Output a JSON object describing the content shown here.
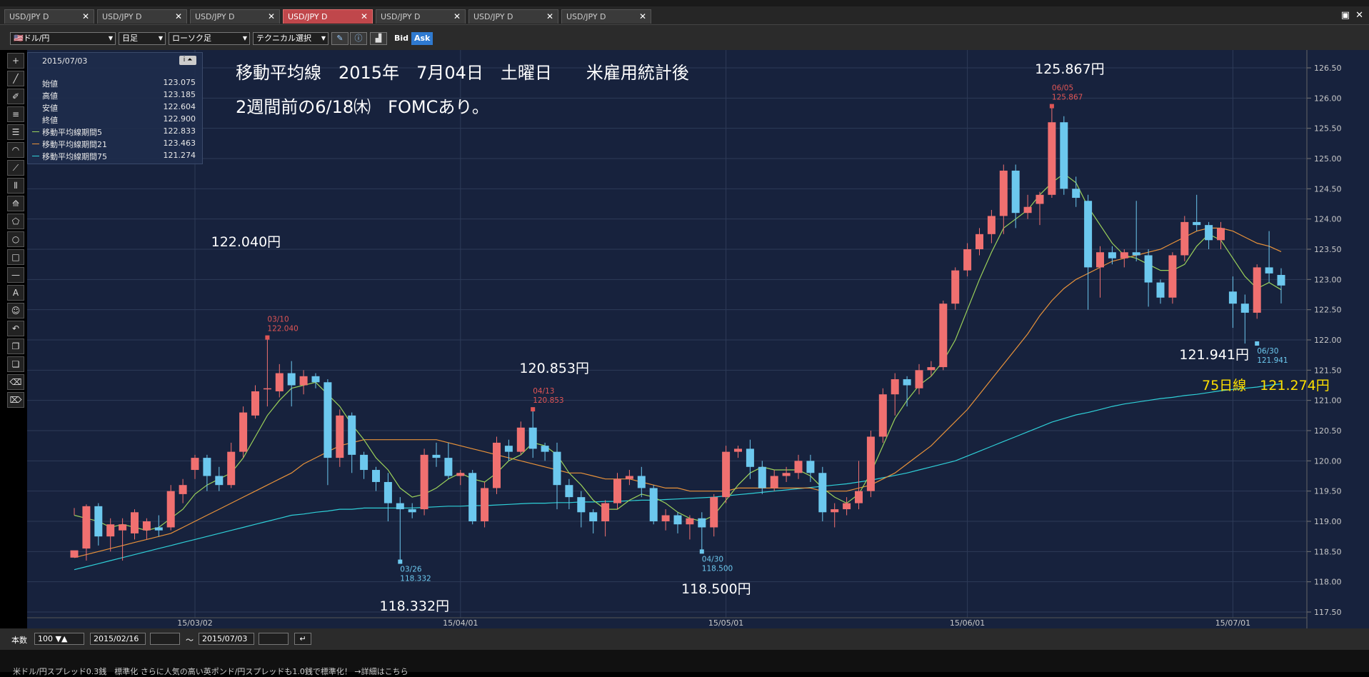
{
  "tabs": [
    {
      "label": "USD/JPY D",
      "active": false
    },
    {
      "label": "USD/JPY D",
      "active": false
    },
    {
      "label": "USD/JPY D",
      "active": false
    },
    {
      "label": "USD/JPY D",
      "active": true
    },
    {
      "label": "USD/JPY D",
      "active": false
    },
    {
      "label": "USD/JPY D",
      "active": false
    },
    {
      "label": "USD/JPY D",
      "active": false
    }
  ],
  "toolbar": {
    "pair": "ドル/円",
    "timeframe": "日足",
    "chart_type": "ローソク足",
    "technical": "テクニカル選択",
    "bid": "Bid",
    "ask": "Ask"
  },
  "info": {
    "date": "2015/07/03",
    "rows": [
      {
        "label": "始値",
        "value": "123.075",
        "color": ""
      },
      {
        "label": "高値",
        "value": "123.185",
        "color": ""
      },
      {
        "label": "安値",
        "value": "122.604",
        "color": ""
      },
      {
        "label": "終値",
        "value": "122.900",
        "color": ""
      },
      {
        "label": "移動平均線期間5",
        "value": "122.833",
        "color": "#9bd15a"
      },
      {
        "label": "移動平均線期間21",
        "value": "123.463",
        "color": "#e8923a"
      },
      {
        "label": "移動平均線期間75",
        "value": "121.274",
        "color": "#2fd0d8"
      }
    ]
  },
  "annotations": {
    "title_line1": "移動平均線　2015年　7月04日　土曜日　　米雇用統計後",
    "title_line2": "2週間前の6/18㈭　FOMCあり。",
    "ma75_label": "75日線　121.274円",
    "callouts": [
      {
        "text": "122.040円",
        "date": "03/10",
        "price": "122.040",
        "kind": "high"
      },
      {
        "text": "118.332円",
        "date": "03/26",
        "price": "118.332",
        "kind": "low"
      },
      {
        "text": "120.853円",
        "date": "04/13",
        "price": "120.853",
        "kind": "high"
      },
      {
        "text": "118.500円",
        "date": "04/30",
        "price": "118.500",
        "kind": "low"
      },
      {
        "text": "125.867円",
        "date": "06/05",
        "price": "125.867",
        "kind": "high"
      },
      {
        "text": "121.941円",
        "date": "06/30",
        "price": "121.941",
        "kind": "low"
      }
    ]
  },
  "bottom": {
    "count_label": "本数",
    "count": "100",
    "from": "2015/02/16",
    "sep": "～",
    "to": "2015/07/03"
  },
  "footer_text": "米ドル/円スプレッド0.3銭　標準化 さらに人気の高い英ポンド/円スプレッドも1.0銭で標準化！ →詳細はこちら",
  "chart_data": {
    "type": "candlestick",
    "symbol": "USD/JPY D",
    "ylim": [
      117.5,
      126.5
    ],
    "yticks": [
      "117.50",
      "118.00",
      "118.50",
      "119.00",
      "119.50",
      "120.00",
      "120.50",
      "121.00",
      "121.50",
      "122.00",
      "122.50",
      "123.00",
      "123.50",
      "124.00",
      "124.50",
      "125.00",
      "125.50",
      "126.00",
      "126.50"
    ],
    "xticks": [
      {
        "label": "15/03/02",
        "index": 10
      },
      {
        "label": "15/04/01",
        "index": 32
      },
      {
        "label": "15/05/01",
        "index": 54
      },
      {
        "label": "15/06/01",
        "index": 74
      },
      {
        "label": "15/07/01",
        "index": 96
      }
    ],
    "candles": [
      [
        118.4,
        118.52,
        119.1,
        119.22
      ],
      [
        118.55,
        119.25,
        118.35,
        119.28
      ],
      [
        119.25,
        118.75,
        118.6,
        119.3
      ],
      [
        118.75,
        118.95,
        118.5,
        119.05
      ],
      [
        118.85,
        118.95,
        118.35,
        119.05
      ],
      [
        118.8,
        119.15,
        118.7,
        119.2
      ],
      [
        118.85,
        119.0,
        118.7,
        119.05
      ],
      [
        118.9,
        118.85,
        118.75,
        119.1
      ],
      [
        118.9,
        119.5,
        118.85,
        119.6
      ],
      [
        119.45,
        119.6,
        119.3,
        119.7
      ],
      [
        119.85,
        120.05,
        119.7,
        120.1
      ],
      [
        120.05,
        119.75,
        119.5,
        120.1
      ],
      [
        119.75,
        119.6,
        119.5,
        119.9
      ],
      [
        119.6,
        120.15,
        119.55,
        120.3
      ],
      [
        120.15,
        120.8,
        120.05,
        120.9
      ],
      [
        120.75,
        121.15,
        120.7,
        121.25
      ],
      [
        121.2,
        121.2,
        120.9,
        122.04
      ],
      [
        121.15,
        121.45,
        121.05,
        121.6
      ],
      [
        121.45,
        121.25,
        120.9,
        121.65
      ],
      [
        121.25,
        121.4,
        121.1,
        121.5
      ],
      [
        121.4,
        121.3,
        121.2,
        121.45
      ],
      [
        121.3,
        120.05,
        119.6,
        121.35
      ],
      [
        120.05,
        120.75,
        119.9,
        120.85
      ],
      [
        120.75,
        120.1,
        119.8,
        120.8
      ],
      [
        120.1,
        119.85,
        119.7,
        120.15
      ],
      [
        119.85,
        119.65,
        119.5,
        119.9
      ],
      [
        119.65,
        119.3,
        119.0,
        119.8
      ],
      [
        119.3,
        119.2,
        118.33,
        119.4
      ],
      [
        119.2,
        119.15,
        119.05,
        119.3
      ],
      [
        119.2,
        120.1,
        119.1,
        120.2
      ],
      [
        120.1,
        120.05,
        119.9,
        120.3
      ],
      [
        120.05,
        119.75,
        119.7,
        120.3
      ],
      [
        119.75,
        119.8,
        119.6,
        119.85
      ],
      [
        119.8,
        119.0,
        118.95,
        119.85
      ],
      [
        119.0,
        119.55,
        118.9,
        119.65
      ],
      [
        119.55,
        120.3,
        119.45,
        120.4
      ],
      [
        120.25,
        120.15,
        120.0,
        120.35
      ],
      [
        120.15,
        120.55,
        120.1,
        120.65
      ],
      [
        120.55,
        120.2,
        120.05,
        120.85
      ],
      [
        120.25,
        120.15,
        120.0,
        120.3
      ],
      [
        120.15,
        119.6,
        119.2,
        120.3
      ],
      [
        119.6,
        119.4,
        119.2,
        119.7
      ],
      [
        119.4,
        119.15,
        118.9,
        119.5
      ],
      [
        119.15,
        119.0,
        118.8,
        119.2
      ],
      [
        119.0,
        119.3,
        118.75,
        119.35
      ],
      [
        119.3,
        119.7,
        119.2,
        119.8
      ],
      [
        119.7,
        119.75,
        119.6,
        119.85
      ],
      [
        119.75,
        119.55,
        119.4,
        119.9
      ],
      [
        119.55,
        119.0,
        118.95,
        119.6
      ],
      [
        119.0,
        119.1,
        118.85,
        119.2
      ],
      [
        119.1,
        118.95,
        118.8,
        119.15
      ],
      [
        118.95,
        119.05,
        118.7,
        119.1
      ],
      [
        119.05,
        118.9,
        118.5,
        119.15
      ],
      [
        118.9,
        119.4,
        118.75,
        119.45
      ],
      [
        119.4,
        120.15,
        119.3,
        120.25
      ],
      [
        120.15,
        120.2,
        120.05,
        120.25
      ],
      [
        120.2,
        119.9,
        119.7,
        120.35
      ],
      [
        119.9,
        119.55,
        119.45,
        120.0
      ],
      [
        119.55,
        119.75,
        119.5,
        119.85
      ],
      [
        119.75,
        119.8,
        119.65,
        119.9
      ],
      [
        119.8,
        120.0,
        119.7,
        120.1
      ],
      [
        120.0,
        119.8,
        119.65,
        120.1
      ],
      [
        119.8,
        119.15,
        119.0,
        119.9
      ],
      [
        119.15,
        119.2,
        118.9,
        119.3
      ],
      [
        119.2,
        119.3,
        119.1,
        119.4
      ],
      [
        119.3,
        119.5,
        119.2,
        120.0
      ],
      [
        119.5,
        120.4,
        119.4,
        120.5
      ],
      [
        120.4,
        121.1,
        120.3,
        121.2
      ],
      [
        121.1,
        121.35,
        120.75,
        121.45
      ],
      [
        121.35,
        121.25,
        120.9,
        121.4
      ],
      [
        121.2,
        121.5,
        121.1,
        121.6
      ],
      [
        121.5,
        121.55,
        121.4,
        121.65
      ],
      [
        121.55,
        122.6,
        121.5,
        122.65
      ],
      [
        122.6,
        123.15,
        122.5,
        123.2
      ],
      [
        123.15,
        123.5,
        123.05,
        123.6
      ],
      [
        123.5,
        123.75,
        123.4,
        123.85
      ],
      [
        123.75,
        124.05,
        123.6,
        124.15
      ],
      [
        124.05,
        124.8,
        123.75,
        124.9
      ],
      [
        124.8,
        124.1,
        123.85,
        124.9
      ],
      [
        124.1,
        124.2,
        124.0,
        124.4
      ],
      [
        124.25,
        124.4,
        123.9,
        124.45
      ],
      [
        124.4,
        125.6,
        124.35,
        125.87
      ],
      [
        125.6,
        124.5,
        124.4,
        125.7
      ],
      [
        124.5,
        124.35,
        124.2,
        124.7
      ],
      [
        124.3,
        123.2,
        122.5,
        124.4
      ],
      [
        123.2,
        123.45,
        122.7,
        123.55
      ],
      [
        123.45,
        123.35,
        123.25,
        123.55
      ],
      [
        123.35,
        123.45,
        123.2,
        123.5
      ],
      [
        123.45,
        123.4,
        123.3,
        124.3
      ],
      [
        123.4,
        122.95,
        122.55,
        123.5
      ],
      [
        122.95,
        122.7,
        122.6,
        123.0
      ],
      [
        122.7,
        123.4,
        122.6,
        123.45
      ],
      [
        123.4,
        123.95,
        123.3,
        124.05
      ],
      [
        123.95,
        123.9,
        123.8,
        124.4
      ],
      [
        123.9,
        123.65,
        123.5,
        123.95
      ],
      [
        123.65,
        123.85,
        123.5,
        123.95
      ],
      [
        122.8,
        122.6,
        122.2,
        123.05
      ],
      [
        122.6,
        122.45,
        121.94,
        122.75
      ],
      [
        122.45,
        123.2,
        122.35,
        123.25
      ],
      [
        123.2,
        123.1,
        122.95,
        123.8
      ],
      [
        123.075,
        122.9,
        122.604,
        123.185
      ]
    ],
    "ma5": [
      119.1,
      119.05,
      119.0,
      118.9,
      118.95,
      118.9,
      118.85,
      118.9,
      119.05,
      119.2,
      119.45,
      119.6,
      119.7,
      119.8,
      120.05,
      120.4,
      120.75,
      121.0,
      121.2,
      121.25,
      121.3,
      121.1,
      120.9,
      120.6,
      120.35,
      120.05,
      119.85,
      119.55,
      119.4,
      119.45,
      119.55,
      119.7,
      119.8,
      119.7,
      119.65,
      119.8,
      120.0,
      120.1,
      120.3,
      120.25,
      120.1,
      119.8,
      119.6,
      119.35,
      119.2,
      119.2,
      119.35,
      119.45,
      119.4,
      119.3,
      119.15,
      119.05,
      119.0,
      119.1,
      119.35,
      119.6,
      119.8,
      119.9,
      119.85,
      119.85,
      119.85,
      119.75,
      119.55,
      119.4,
      119.3,
      119.45,
      119.8,
      120.25,
      120.7,
      121.0,
      121.25,
      121.4,
      121.65,
      122.0,
      122.5,
      123.0,
      123.45,
      123.85,
      124.0,
      124.15,
      124.4,
      124.6,
      124.75,
      124.6,
      124.2,
      123.9,
      123.6,
      123.4,
      123.35,
      123.25,
      123.15,
      123.15,
      123.25,
      123.55,
      123.75,
      123.65,
      123.35,
      123.05,
      122.85,
      122.95,
      122.83
    ],
    "ma21": [
      118.4,
      118.45,
      118.5,
      118.55,
      118.6,
      118.65,
      118.7,
      118.75,
      118.8,
      118.9,
      119.0,
      119.1,
      119.2,
      119.3,
      119.4,
      119.5,
      119.6,
      119.7,
      119.8,
      119.95,
      120.05,
      120.15,
      120.25,
      120.3,
      120.35,
      120.35,
      120.35,
      120.35,
      120.35,
      120.35,
      120.35,
      120.3,
      120.25,
      120.2,
      120.15,
      120.1,
      120.05,
      120.0,
      119.95,
      119.9,
      119.85,
      119.8,
      119.8,
      119.75,
      119.7,
      119.7,
      119.7,
      119.65,
      119.6,
      119.55,
      119.55,
      119.5,
      119.5,
      119.5,
      119.5,
      119.55,
      119.55,
      119.55,
      119.55,
      119.55,
      119.55,
      119.55,
      119.5,
      119.5,
      119.5,
      119.55,
      119.6,
      119.7,
      119.8,
      119.95,
      120.1,
      120.25,
      120.45,
      120.65,
      120.85,
      121.1,
      121.35,
      121.6,
      121.85,
      122.1,
      122.4,
      122.65,
      122.85,
      123.0,
      123.1,
      123.2,
      123.3,
      123.35,
      123.4,
      123.45,
      123.5,
      123.6,
      123.7,
      123.8,
      123.85,
      123.85,
      123.8,
      123.7,
      123.6,
      123.55,
      123.46
    ],
    "ma75": [
      118.2,
      118.25,
      118.3,
      118.35,
      118.4,
      118.45,
      118.5,
      118.55,
      118.6,
      118.65,
      118.7,
      118.75,
      118.8,
      118.85,
      118.9,
      118.95,
      119.0,
      119.05,
      119.1,
      119.12,
      119.15,
      119.17,
      119.2,
      119.2,
      119.22,
      119.22,
      119.22,
      119.22,
      119.22,
      119.23,
      119.24,
      119.25,
      119.25,
      119.26,
      119.26,
      119.27,
      119.28,
      119.29,
      119.3,
      119.3,
      119.31,
      119.31,
      119.32,
      119.32,
      119.33,
      119.33,
      119.34,
      119.35,
      119.35,
      119.36,
      119.37,
      119.38,
      119.39,
      119.4,
      119.42,
      119.44,
      119.46,
      119.48,
      119.5,
      119.52,
      119.54,
      119.56,
      119.58,
      119.6,
      119.62,
      119.65,
      119.68,
      119.72,
      119.76,
      119.8,
      119.85,
      119.9,
      119.95,
      120.0,
      120.08,
      120.16,
      120.24,
      120.32,
      120.4,
      120.48,
      120.56,
      120.64,
      120.7,
      120.76,
      120.8,
      120.85,
      120.9,
      120.94,
      120.97,
      121.0,
      121.03,
      121.05,
      121.08,
      121.1,
      121.13,
      121.16,
      121.18,
      121.2,
      121.22,
      121.25,
      121.274
    ]
  }
}
